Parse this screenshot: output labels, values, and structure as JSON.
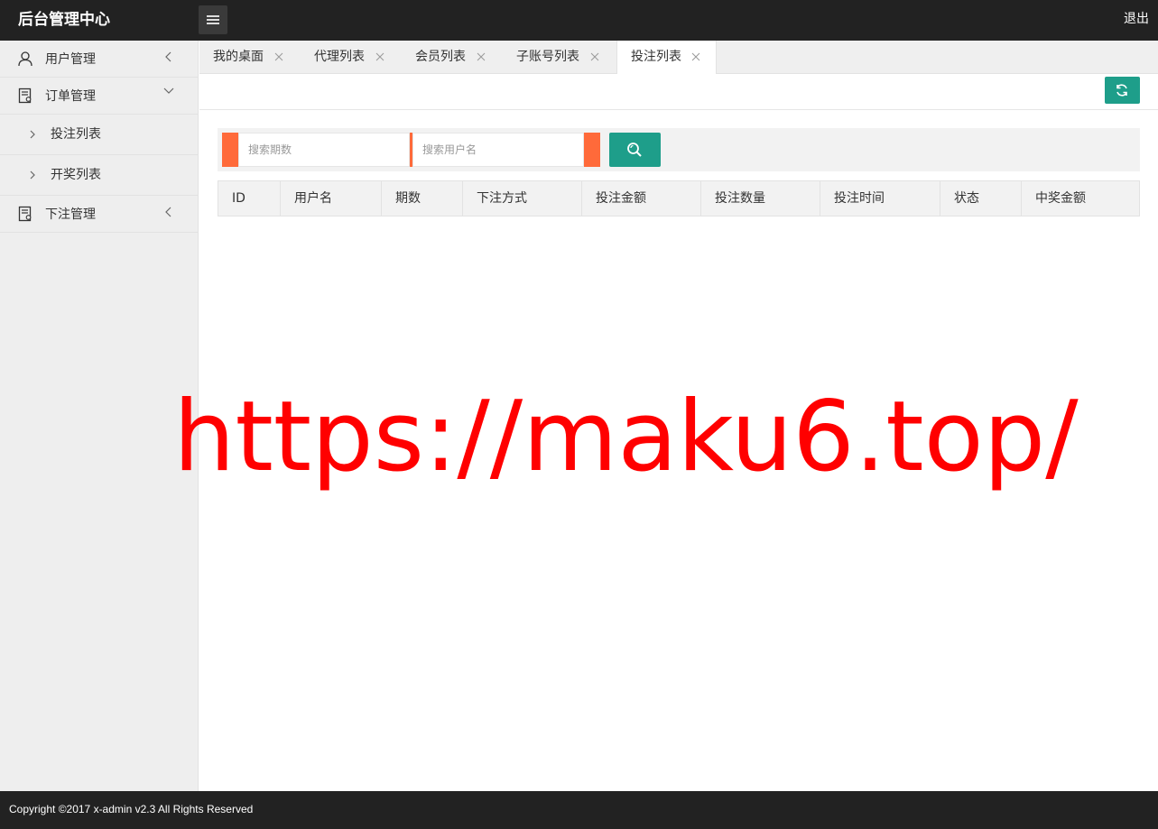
{
  "header": {
    "title": "后台管理中心",
    "logout_label": "退出"
  },
  "sidebar": {
    "items": [
      {
        "label": "用户管理",
        "icon": "user-icon",
        "arrow": "chevron-left-icon"
      },
      {
        "label": "订单管理",
        "icon": "document-icon",
        "arrow": "chevron-down-icon",
        "expanded": true
      },
      {
        "label": "投注列表",
        "icon": "chevron-right-icon"
      },
      {
        "label": "开奖列表",
        "icon": "chevron-right-icon"
      },
      {
        "label": "下注管理",
        "icon": "document-icon",
        "arrow": "chevron-left-icon"
      }
    ]
  },
  "tabs": [
    {
      "label": "我的桌面"
    },
    {
      "label": "代理列表"
    },
    {
      "label": "会员列表"
    },
    {
      "label": "子账号列表"
    },
    {
      "label": "投注列表",
      "active": true
    }
  ],
  "search": {
    "period_placeholder": "搜索期数",
    "username_placeholder": "搜索用户名"
  },
  "table": {
    "columns": [
      "ID",
      "用户名",
      "期数",
      "下注方式",
      "投注金额",
      "投注数量",
      "投注时间",
      "状态",
      "中奖金额"
    ],
    "rows": []
  },
  "watermark": "https://maku6.top/",
  "footer": {
    "copyright": "Copyright ©2017 x-admin v2.3 All Rights Reserved"
  },
  "colors": {
    "accent": "#1e9e8a",
    "orange": "#ff6a3a",
    "header_bg": "#222222",
    "watermark": "#ff0000"
  }
}
